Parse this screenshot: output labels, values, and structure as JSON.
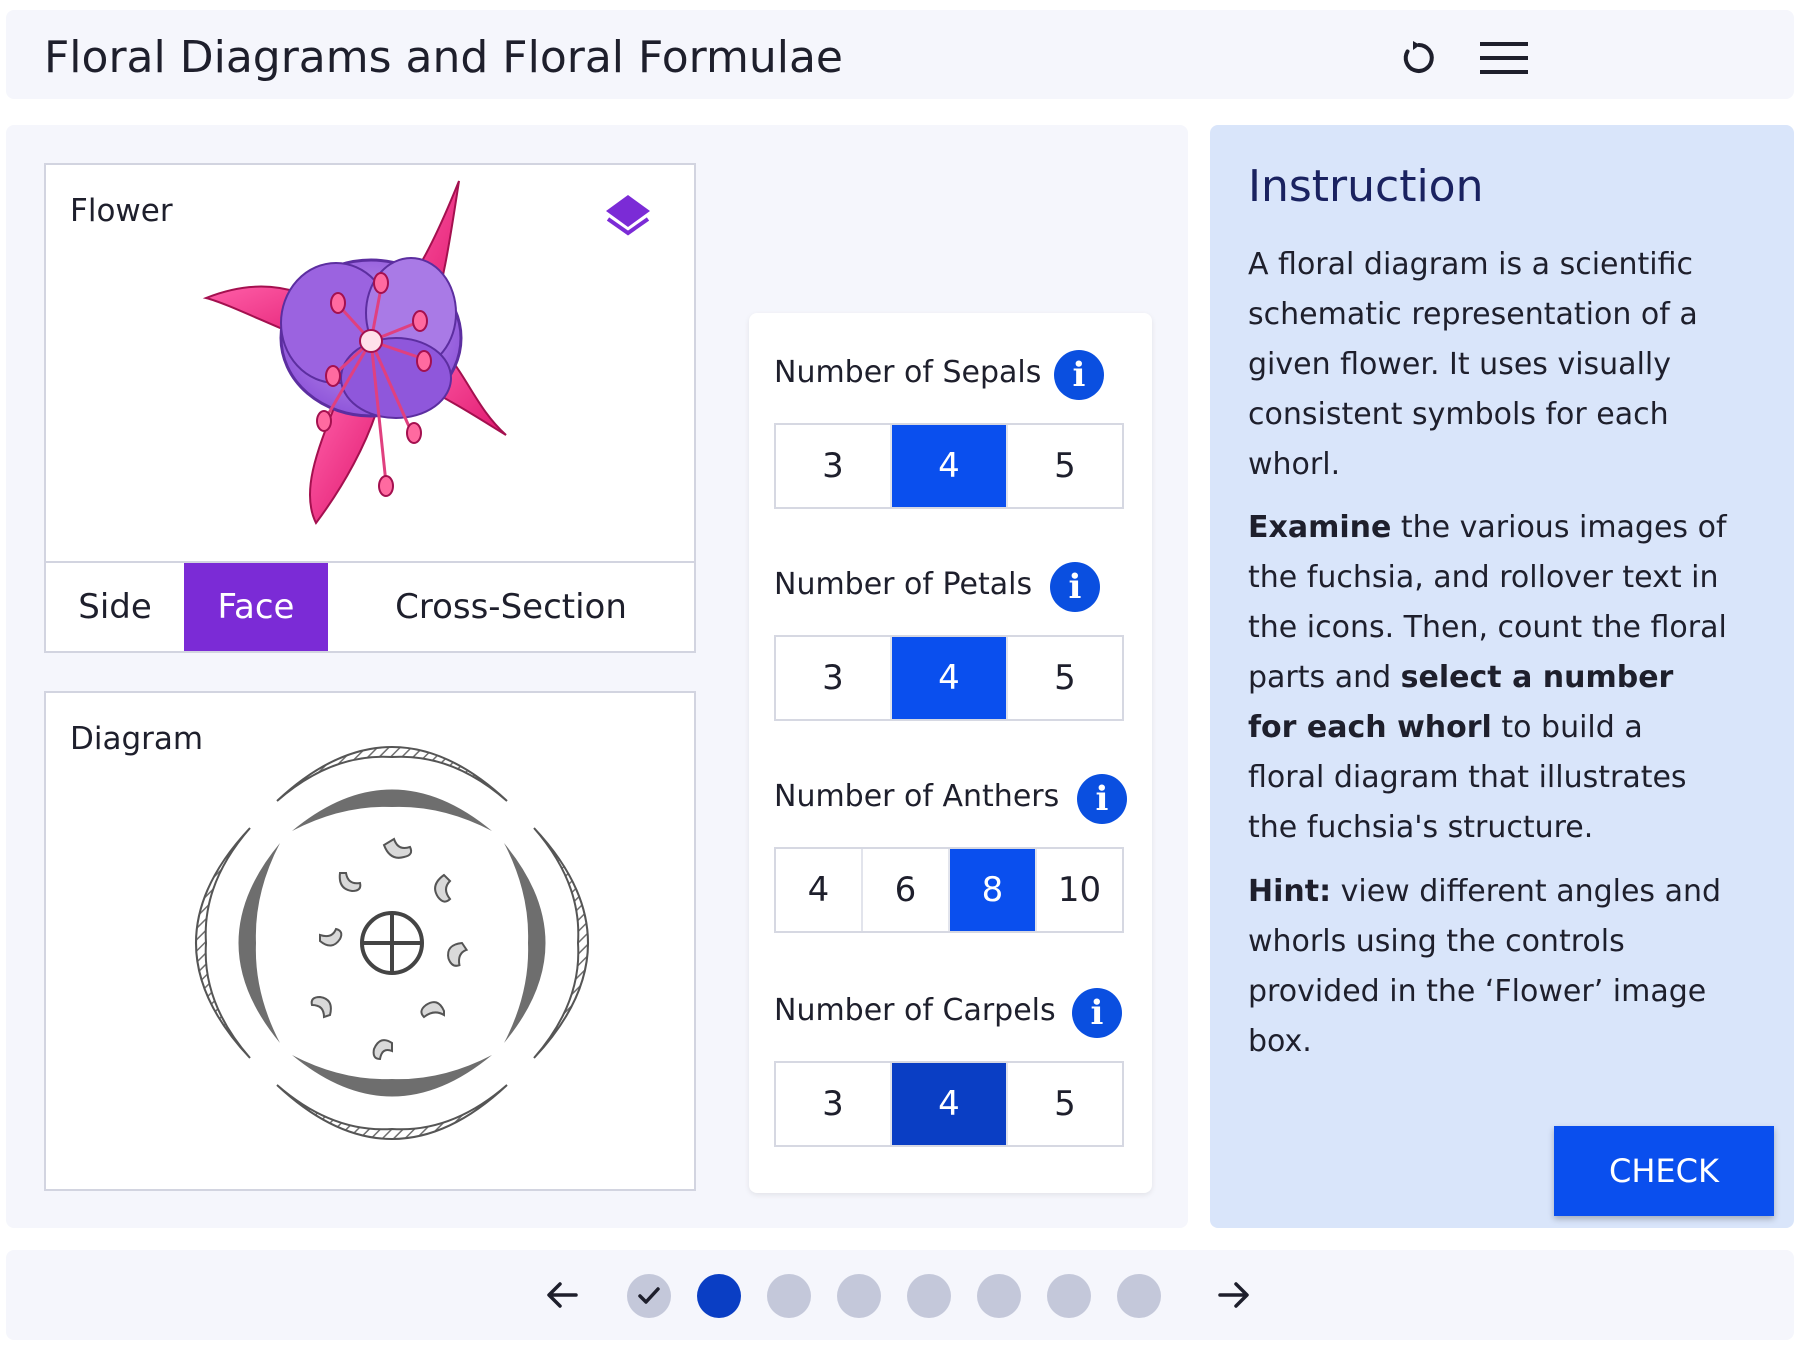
{
  "header": {
    "title": "Floral Diagrams and Floral Formulae",
    "reset_icon": "reset-icon",
    "menu_icon": "hamburger-menu-icon"
  },
  "flower_panel": {
    "label": "Flower",
    "layers_icon": "layers-icon",
    "view_tabs": [
      {
        "label": "Side",
        "active": false
      },
      {
        "label": "Face",
        "active": true
      },
      {
        "label": "Cross-Section",
        "active": false
      }
    ]
  },
  "diagram_panel": {
    "label": "Diagram"
  },
  "controls": [
    {
      "label": "Number of Sepals",
      "info": "i",
      "options": [
        "3",
        "4",
        "5"
      ],
      "selected": "4"
    },
    {
      "label": "Number of Petals",
      "info": "i",
      "options": [
        "3",
        "4",
        "5"
      ],
      "selected": "4"
    },
    {
      "label": "Number of Anthers",
      "info": "i",
      "options": [
        "4",
        "6",
        "8",
        "10"
      ],
      "selected": "8"
    },
    {
      "label": "Number of Carpels",
      "info": "i",
      "options": [
        "3",
        "4",
        "5"
      ],
      "selected": "4"
    }
  ],
  "instruction": {
    "title": "Instruction",
    "p1": "A floral diagram is a scientific schematic representation of a given flower. It uses visually consistent symbols for each whorl.",
    "p2_bold1": "Examine",
    "p2_text1": " the various images of the fuchsia, and rollover text in the icons. Then, count the floral parts and ",
    "p2_bold2": "select a number for each whorl",
    "p2_text2": " to build a floral diagram that illustrates the fuchsia's structure.",
    "p3_bold": "Hint:",
    "p3_text": " view different angles and whorls using the controls provided in the ‘Flower’ image box.",
    "check_label": "CHECK"
  },
  "footer": {
    "prev_icon": "arrow-left-icon",
    "next_icon": "arrow-right-icon",
    "pages": [
      {
        "state": "done"
      },
      {
        "state": "current"
      },
      {
        "state": "todo"
      },
      {
        "state": "todo"
      },
      {
        "state": "todo"
      },
      {
        "state": "todo"
      },
      {
        "state": "todo"
      },
      {
        "state": "todo"
      }
    ]
  },
  "colors": {
    "accent_blue": "#0a4fee",
    "accent_dark_blue": "#0a3ec4",
    "accent_purple": "#7b2bd6",
    "panel_bg": "#f5f6fc",
    "instruction_bg": "#d9e5fa"
  }
}
